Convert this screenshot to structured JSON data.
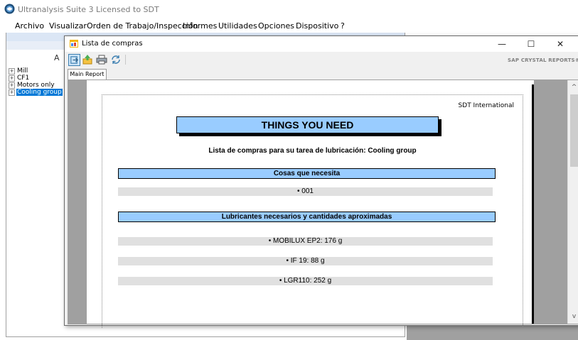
{
  "app": {
    "title": "Ultranalysis Suite 3 Licensed to SDT",
    "menu": [
      "Archivo",
      "Visualizar",
      "Orden de Trabajo/Inspección",
      "Informes",
      "Utilidades",
      "Opciones",
      "Dispositivo",
      "?"
    ]
  },
  "left_panel": {
    "partial_letter": "A",
    "tree": [
      {
        "label": "Mill",
        "selected": false
      },
      {
        "label": "CF1",
        "selected": false
      },
      {
        "label": "Motors only",
        "selected": false
      },
      {
        "label": "Cooling group",
        "selected": true
      }
    ]
  },
  "dialog": {
    "title": "Lista de compras",
    "minimize": "—",
    "maximize": "☐",
    "close": "✕",
    "brand": "SAP CRYSTAL REPORTS®",
    "tab": "Main Report",
    "scroll_up": "^",
    "scroll_down": "v",
    "toolbar_icons": [
      "export-icon",
      "upload-icon",
      "print-icon",
      "refresh-icon"
    ]
  },
  "report": {
    "company": "SDT International",
    "banner": "THINGS YOU NEED",
    "subtitle": "Lista de compras para su tarea de lubricación: Cooling group",
    "sections": [
      {
        "header": "Cosas que necesita",
        "items": [
          "• 001"
        ]
      },
      {
        "header": "Lubricantes necesarios y cantidades aproximadas",
        "items": [
          "• MOBILUX EP2: 176 g",
          "• IF 19: 88 g",
          "• LGR110: 252 g"
        ]
      }
    ]
  },
  "colors": {
    "banner_fill": "#99ccff",
    "selected_tree": "#0078d7",
    "viewer_gray": "#a0a0a0",
    "row_fill": "#e0e0e0"
  }
}
